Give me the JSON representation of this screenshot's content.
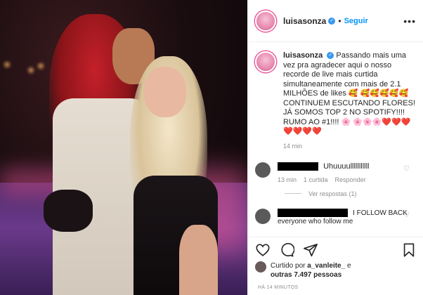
{
  "header": {
    "username": "luisasonza",
    "separator": "•",
    "follow_label": "Seguir",
    "more_label": "•••"
  },
  "caption": {
    "username": "luisasonza",
    "text": "Passando mais uma vez pra agradecer aqui o nosso recorde de live mais curtida simultaneamente com mais de 2.1 MILHÕES de likes 🥰 🥰🥰🥰🥰🥰 CONTINUEM ESCUTANDO FLORES! JÁ SOMOS TOP 2 NO SPOTIFY!!!! RUMO AO #1!!!! 🌸 🌸🌸🌸❤️❤️❤️❤️❤️❤️❤️",
    "time": "14 min"
  },
  "comments": [
    {
      "text": "Uhuuuulllllllllll",
      "time": "13 min",
      "likes": "1 curtida",
      "reply": "Responder",
      "view_replies": "Ver respostas (1)"
    },
    {
      "text": "I FOLLOW BACK everyone who follow me"
    }
  ],
  "likes": {
    "prefix": "Curtido por",
    "user": "a_vanleite_",
    "connector": "e",
    "others": "outras 7.497 pessoas"
  },
  "posted_ago": "HÁ 14 MINUTOS",
  "colors": {
    "follow_blue": "#0095f6",
    "verified_blue": "#3897f0",
    "meta_gray": "#8e8e8e"
  },
  "icons": [
    "verified-badge-icon",
    "heart-icon",
    "comment-icon",
    "share-icon",
    "bookmark-icon"
  ]
}
